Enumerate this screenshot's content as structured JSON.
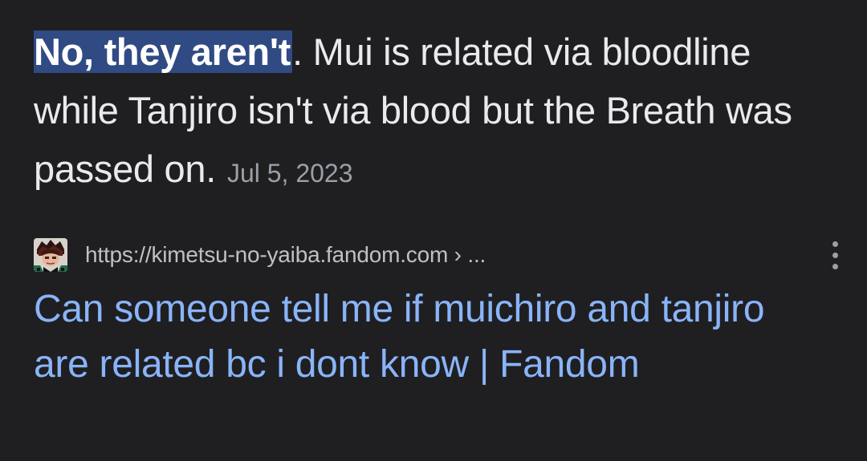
{
  "snippet": {
    "highlight": "No, they aren't",
    "text": ". Mui is related via bloodline while Tanjiro isn't via blood but the Breath was passed on.",
    "date": "Jul 5, 2023"
  },
  "source": {
    "favicon_icon": "fandom-character-avatar",
    "url": "https://kimetsu-no-yaiba.fandom.com › ...",
    "more_icon": "vertical-ellipsis-icon"
  },
  "result": {
    "title": "Can someone tell me if muichiro and tanjiro are related bc i dont know | Fandom"
  },
  "colors": {
    "background": "#1f1f22",
    "text": "#e8eaed",
    "highlight_bg": "#304a83",
    "link": "#8ab4f8",
    "muted": "#9aa0a6"
  }
}
